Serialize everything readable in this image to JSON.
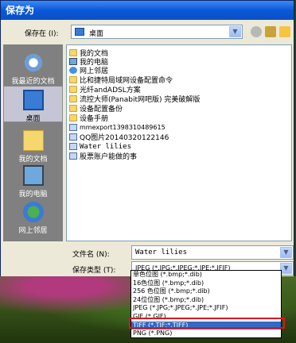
{
  "dialog": {
    "title": "保存为"
  },
  "save_in": {
    "label": "保存在 (I):",
    "value": "桌面"
  },
  "places": [
    {
      "label": "我最近的文档",
      "icon": "recent-documents-icon"
    },
    {
      "label": "桌面",
      "icon": "desktop-icon"
    },
    {
      "label": "我的文档",
      "icon": "my-documents-icon"
    },
    {
      "label": "我的电脑",
      "icon": "my-computer-icon"
    },
    {
      "label": "网上邻居",
      "icon": "network-places-icon"
    }
  ],
  "files": [
    {
      "name": "我的文档",
      "icon": "folder-icon"
    },
    {
      "name": "我的电脑",
      "icon": "computer-icon"
    },
    {
      "name": "网上邻居",
      "icon": "network-icon"
    },
    {
      "name": "比和捷特局域网设备配置命令",
      "icon": "folder-icon"
    },
    {
      "name": "光纤andADSL方案",
      "icon": "folder-icon"
    },
    {
      "name": "流控大师(Panabit网吧版) 完美破解版",
      "icon": "folder-icon"
    },
    {
      "name": "设备配置备份",
      "icon": "folder-icon"
    },
    {
      "name": "设备手册",
      "icon": "folder-icon"
    },
    {
      "name": "mmexport1398310489615",
      "icon": "image-icon"
    },
    {
      "name": "QQ图片20140320122146",
      "icon": "image-icon"
    },
    {
      "name": "Water lilies",
      "icon": "image-icon"
    },
    {
      "name": "股票账户能做的事",
      "icon": "image-icon"
    }
  ],
  "filename": {
    "label": "文件名 (N):",
    "value": "Water lilies"
  },
  "filetype": {
    "label": "保存类型 (T):",
    "value": "JPEG (*.JPG;*.JPEG;*.JPE;*.JFIF)",
    "options": [
      "单色位图 (*.bmp;*.dib)",
      "16色位图 (*.bmp;*.dib)",
      "256 色位图 (*.bmp;*.dib)",
      "24位位图 (*.bmp;*.dib)",
      "JPEG (*.JPG;*.JPEG;*.JPE;*.JFIF)",
      "GIF (*.GIF)",
      "TIFF (*.TIF;*.TIFF)",
      "PNG (*.PNG)"
    ],
    "highlighted_index": 6
  },
  "colors": {
    "highlight": "#316ac5",
    "annotation": "#e0131a",
    "title_bar": "#0a58d8"
  }
}
